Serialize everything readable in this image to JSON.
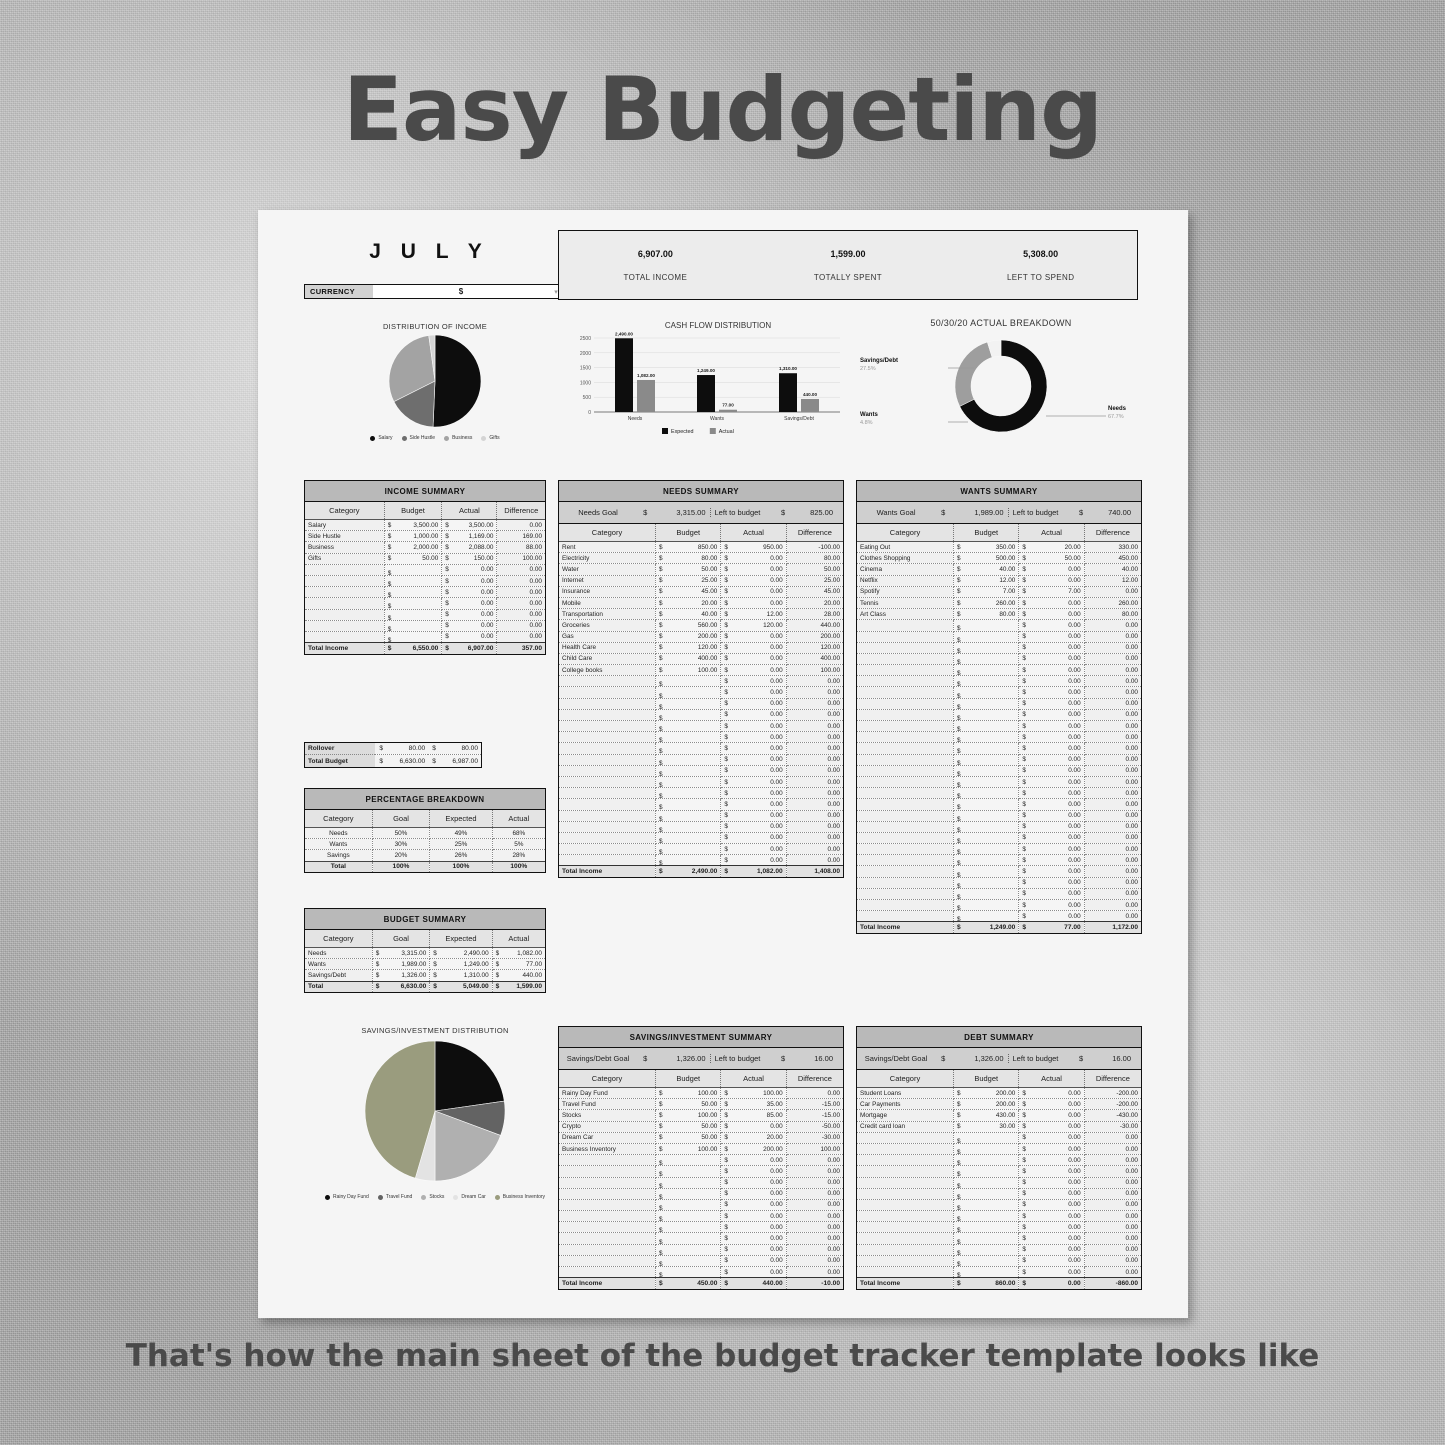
{
  "headline": "Easy Budgeting",
  "footer": "That's how the main sheet of the budget tracker template looks like",
  "sheet": {
    "month": "J U L Y",
    "currency_label": "CURRENCY",
    "currency_value": "$",
    "kpis": [
      {
        "value": "6,907.00",
        "label": "TOTAL INCOME"
      },
      {
        "value": "1,599.00",
        "label": "TOTALLY SPENT"
      },
      {
        "value": "5,308.00",
        "label": "LEFT TO SPEND"
      }
    ]
  },
  "chart_data": [
    {
      "type": "pie",
      "title": "DISTRIBUTION OF INCOME",
      "categories": [
        "Salary",
        "Side Hustle",
        "Business",
        "Gifts"
      ],
      "values": [
        3500,
        1169,
        2088,
        150
      ],
      "colors": [
        "#0d0d0d",
        "#6e6e6e",
        "#a3a3a3",
        "#d4d4d4"
      ],
      "legend_position": "bottom"
    },
    {
      "type": "bar",
      "title": "CASH FLOW DISTRIBUTION",
      "categories": [
        "Needs",
        "Wants",
        "Savings/Debt"
      ],
      "series": [
        {
          "name": "Expected",
          "values": [
            2490,
            1249,
            1310
          ],
          "color": "#0d0d0d"
        },
        {
          "name": "Actual",
          "values": [
            1082,
            77,
            440
          ],
          "color": "#8a8a8a"
        }
      ],
      "data_labels": [
        [
          "2,490.00",
          "1,249.00",
          "1,310.00"
        ],
        [
          "1,082.00",
          "77.00",
          "440.00"
        ]
      ],
      "ylabel": "",
      "xlabel": "",
      "ylim": [
        0,
        2500
      ],
      "yticks": [
        "0",
        "500",
        "1000",
        "1500",
        "2000",
        "2500"
      ],
      "grid": true,
      "legend_position": "bottom"
    },
    {
      "type": "pie",
      "title": "50/30/20 ACTUAL BREAKDOWN",
      "donut": true,
      "categories": [
        "Needs",
        "Savings/Debt",
        "Wants"
      ],
      "values": [
        67.7,
        27.5,
        4.8
      ],
      "value_labels": [
        "67.7%",
        "27.5%",
        "4.8%"
      ],
      "colors": [
        "#0d0d0d",
        "#9e9e9e",
        "#f2f2f2"
      ]
    },
    {
      "type": "pie",
      "title": "SAVINGS/INVESTMENT DISTRIBUTION",
      "categories": [
        "Rainy Day Fund",
        "Travel Fund",
        "Stocks",
        "Dream Car",
        "Business Inventory"
      ],
      "values": [
        100,
        35,
        85,
        20,
        200
      ],
      "colors": [
        "#0d0d0d",
        "#636363",
        "#b0b0b0",
        "#e3e3e3",
        "#9a9c7e"
      ],
      "legend_position": "bottom"
    }
  ],
  "income_summary": {
    "title": "INCOME SUMMARY",
    "headers": [
      "Category",
      "Budget",
      "Actual",
      "Difference"
    ],
    "rows": [
      [
        "Salary",
        "3,500.00",
        "3,500.00",
        "0.00"
      ],
      [
        "Side Hustle",
        "1,000.00",
        "1,169.00",
        "169.00"
      ],
      [
        "Business",
        "2,000.00",
        "2,088.00",
        "88.00"
      ],
      [
        "Gifts",
        "50.00",
        "150.00",
        "100.00"
      ],
      [
        "",
        "",
        "0.00",
        "0.00"
      ],
      [
        "",
        "",
        "0.00",
        "0.00"
      ],
      [
        "",
        "",
        "0.00",
        "0.00"
      ],
      [
        "",
        "",
        "0.00",
        "0.00"
      ],
      [
        "",
        "",
        "0.00",
        "0.00"
      ],
      [
        "",
        "",
        "0.00",
        "0.00"
      ],
      [
        "",
        "",
        "0.00",
        "0.00"
      ]
    ],
    "total": [
      "Total Income",
      "6,550.00",
      "6,907.00",
      "357.00"
    ]
  },
  "rollover": {
    "rows": [
      [
        "Rollover",
        "80.00",
        "80.00"
      ],
      [
        "Total Budget",
        "6,630.00",
        "6,987.00"
      ]
    ]
  },
  "percentage_breakdown": {
    "title": "PERCENTAGE BREAKDOWN",
    "headers": [
      "Category",
      "Goal",
      "Expected",
      "Actual"
    ],
    "rows": [
      [
        "Needs",
        "50%",
        "49%",
        "68%"
      ],
      [
        "Wants",
        "30%",
        "25%",
        "5%"
      ],
      [
        "Savings",
        "20%",
        "26%",
        "28%"
      ]
    ],
    "total": [
      "Total",
      "100%",
      "100%",
      "100%"
    ]
  },
  "budget_summary": {
    "title": "BUDGET SUMMARY",
    "headers": [
      "Category",
      "Goal",
      "Expected",
      "Actual"
    ],
    "rows": [
      [
        "Needs",
        "3,315.00",
        "2,490.00",
        "1,082.00"
      ],
      [
        "Wants",
        "1,989.00",
        "1,249.00",
        "77.00"
      ],
      [
        "Savings/Debt",
        "1,326.00",
        "1,310.00",
        "440.00"
      ]
    ],
    "total": [
      "Total",
      "6,630.00",
      "5,049.00",
      "1,599.00"
    ]
  },
  "needs_summary": {
    "title": "NEEDS SUMMARY",
    "goal_label": "Needs Goal",
    "goal_value": "3,315.00",
    "left_label": "Left to budget",
    "left_value": "825.00",
    "headers": [
      "Category",
      "Budget",
      "Actual",
      "Difference"
    ],
    "rows": [
      [
        "Rent",
        "850.00",
        "950.00",
        "-100.00"
      ],
      [
        "Electricity",
        "80.00",
        "0.00",
        "80.00"
      ],
      [
        "Water",
        "50.00",
        "0.00",
        "50.00"
      ],
      [
        "Internet",
        "25.00",
        "0.00",
        "25.00"
      ],
      [
        "Insurance",
        "45.00",
        "0.00",
        "45.00"
      ],
      [
        "Mobile",
        "20.00",
        "0.00",
        "20.00"
      ],
      [
        "Transportation",
        "40.00",
        "12.00",
        "28.00"
      ],
      [
        "Groceries",
        "560.00",
        "120.00",
        "440.00"
      ],
      [
        "Gas",
        "200.00",
        "0.00",
        "200.00"
      ],
      [
        "Health Care",
        "120.00",
        "0.00",
        "120.00"
      ],
      [
        "Child Care",
        "400.00",
        "0.00",
        "400.00"
      ],
      [
        "College books",
        "100.00",
        "0.00",
        "100.00"
      ],
      [
        "",
        "",
        "0.00",
        "0.00"
      ],
      [
        "",
        "",
        "0.00",
        "0.00"
      ],
      [
        "",
        "",
        "0.00",
        "0.00"
      ],
      [
        "",
        "",
        "0.00",
        "0.00"
      ],
      [
        "",
        "",
        "0.00",
        "0.00"
      ],
      [
        "",
        "",
        "0.00",
        "0.00"
      ],
      [
        "",
        "",
        "0.00",
        "0.00"
      ],
      [
        "",
        "",
        "0.00",
        "0.00"
      ],
      [
        "",
        "",
        "0.00",
        "0.00"
      ],
      [
        "",
        "",
        "0.00",
        "0.00"
      ],
      [
        "",
        "",
        "0.00",
        "0.00"
      ],
      [
        "",
        "",
        "0.00",
        "0.00"
      ],
      [
        "",
        "",
        "0.00",
        "0.00"
      ],
      [
        "",
        "",
        "0.00",
        "0.00"
      ],
      [
        "",
        "",
        "0.00",
        "0.00"
      ],
      [
        "",
        "",
        "0.00",
        "0.00"
      ],
      [
        "",
        "",
        "0.00",
        "0.00"
      ]
    ],
    "total": [
      "Total Income",
      "2,490.00",
      "1,082.00",
      "1,408.00"
    ]
  },
  "wants_summary": {
    "title": "WANTS SUMMARY",
    "goal_label": "Wants Goal",
    "goal_value": "1,989.00",
    "left_label": "Left to budget",
    "left_value": "740.00",
    "headers": [
      "Category",
      "Budget",
      "Actual",
      "Difference"
    ],
    "rows": [
      [
        "Eating Out",
        "350.00",
        "20.00",
        "330.00"
      ],
      [
        "Clothes Shopping",
        "500.00",
        "50.00",
        "450.00"
      ],
      [
        "Cinema",
        "40.00",
        "0.00",
        "40.00"
      ],
      [
        "Netflix",
        "12.00",
        "0.00",
        "12.00"
      ],
      [
        "Spotify",
        "7.00",
        "7.00",
        "0.00"
      ],
      [
        "Tennis",
        "260.00",
        "0.00",
        "260.00"
      ],
      [
        "Art Class",
        "80.00",
        "0.00",
        "80.00"
      ],
      [
        "",
        "",
        "0.00",
        "0.00"
      ],
      [
        "",
        "",
        "0.00",
        "0.00"
      ],
      [
        "",
        "",
        "0.00",
        "0.00"
      ],
      [
        "",
        "",
        "0.00",
        "0.00"
      ],
      [
        "",
        "",
        "0.00",
        "0.00"
      ],
      [
        "",
        "",
        "0.00",
        "0.00"
      ],
      [
        "",
        "",
        "0.00",
        "0.00"
      ],
      [
        "",
        "",
        "0.00",
        "0.00"
      ],
      [
        "",
        "",
        "0.00",
        "0.00"
      ],
      [
        "",
        "",
        "0.00",
        "0.00"
      ],
      [
        "",
        "",
        "0.00",
        "0.00"
      ],
      [
        "",
        "",
        "0.00",
        "0.00"
      ],
      [
        "",
        "",
        "0.00",
        "0.00"
      ],
      [
        "",
        "",
        "0.00",
        "0.00"
      ],
      [
        "",
        "",
        "0.00",
        "0.00"
      ],
      [
        "",
        "",
        "0.00",
        "0.00"
      ],
      [
        "",
        "",
        "0.00",
        "0.00"
      ],
      [
        "",
        "",
        "0.00",
        "0.00"
      ],
      [
        "",
        "",
        "0.00",
        "0.00"
      ],
      [
        "",
        "",
        "0.00",
        "0.00"
      ],
      [
        "",
        "",
        "0.00",
        "0.00"
      ],
      [
        "",
        "",
        "0.00",
        "0.00"
      ],
      [
        "",
        "",
        "0.00",
        "0.00"
      ],
      [
        "",
        "",
        "0.00",
        "0.00"
      ],
      [
        "",
        "",
        "0.00",
        "0.00"
      ],
      [
        "",
        "",
        "0.00",
        "0.00"
      ],
      [
        "",
        "",
        "0.00",
        "0.00"
      ]
    ],
    "total": [
      "Total Income",
      "1,249.00",
      "77.00",
      "1,172.00"
    ]
  },
  "savings_summary": {
    "title": "SAVINGS/INVESTMENT SUMMARY",
    "goal_label": "Savings/Debt Goal",
    "goal_value": "1,326.00",
    "left_label": "Left to budget",
    "left_value": "16.00",
    "headers": [
      "Category",
      "Budget",
      "Actual",
      "Difference"
    ],
    "rows": [
      [
        "Rainy Day Fund",
        "100.00",
        "100.00",
        "0.00"
      ],
      [
        "Travel Fund",
        "50.00",
        "35.00",
        "-15.00"
      ],
      [
        "Stocks",
        "100.00",
        "85.00",
        "-15.00"
      ],
      [
        "Crypto",
        "50.00",
        "0.00",
        "-50.00"
      ],
      [
        "Dream Car",
        "50.00",
        "20.00",
        "-30.00"
      ],
      [
        "Business Inventory",
        "100.00",
        "200.00",
        "100.00"
      ],
      [
        "",
        "",
        "0.00",
        "0.00"
      ],
      [
        "",
        "",
        "0.00",
        "0.00"
      ],
      [
        "",
        "",
        "0.00",
        "0.00"
      ],
      [
        "",
        "",
        "0.00",
        "0.00"
      ],
      [
        "",
        "",
        "0.00",
        "0.00"
      ],
      [
        "",
        "",
        "0.00",
        "0.00"
      ],
      [
        "",
        "",
        "0.00",
        "0.00"
      ],
      [
        "",
        "",
        "0.00",
        "0.00"
      ],
      [
        "",
        "",
        "0.00",
        "0.00"
      ],
      [
        "",
        "",
        "0.00",
        "0.00"
      ],
      [
        "",
        "",
        "0.00",
        "0.00"
      ]
    ],
    "total": [
      "Total Income",
      "450.00",
      "440.00",
      "-10.00"
    ]
  },
  "debt_summary": {
    "title": "DEBT SUMMARY",
    "goal_label": "Savings/Debt Goal",
    "goal_value": "1,326.00",
    "left_label": "Left to budget",
    "left_value": "16.00",
    "headers": [
      "Category",
      "Budget",
      "Actual",
      "Difference"
    ],
    "rows": [
      [
        "Student Loans",
        "200.00",
        "0.00",
        "-200.00"
      ],
      [
        "Car Payments",
        "200.00",
        "0.00",
        "-200.00"
      ],
      [
        "Mortgage",
        "430.00",
        "0.00",
        "-430.00"
      ],
      [
        "Credit card loan",
        "30.00",
        "0.00",
        "-30.00"
      ],
      [
        "",
        "",
        "0.00",
        "0.00"
      ],
      [
        "",
        "",
        "0.00",
        "0.00"
      ],
      [
        "",
        "",
        "0.00",
        "0.00"
      ],
      [
        "",
        "",
        "0.00",
        "0.00"
      ],
      [
        "",
        "",
        "0.00",
        "0.00"
      ],
      [
        "",
        "",
        "0.00",
        "0.00"
      ],
      [
        "",
        "",
        "0.00",
        "0.00"
      ],
      [
        "",
        "",
        "0.00",
        "0.00"
      ],
      [
        "",
        "",
        "0.00",
        "0.00"
      ],
      [
        "",
        "",
        "0.00",
        "0.00"
      ],
      [
        "",
        "",
        "0.00",
        "0.00"
      ],
      [
        "",
        "",
        "0.00",
        "0.00"
      ],
      [
        "",
        "",
        "0.00",
        "0.00"
      ]
    ],
    "total": [
      "Total Income",
      "860.00",
      "0.00",
      "-860.00"
    ]
  }
}
